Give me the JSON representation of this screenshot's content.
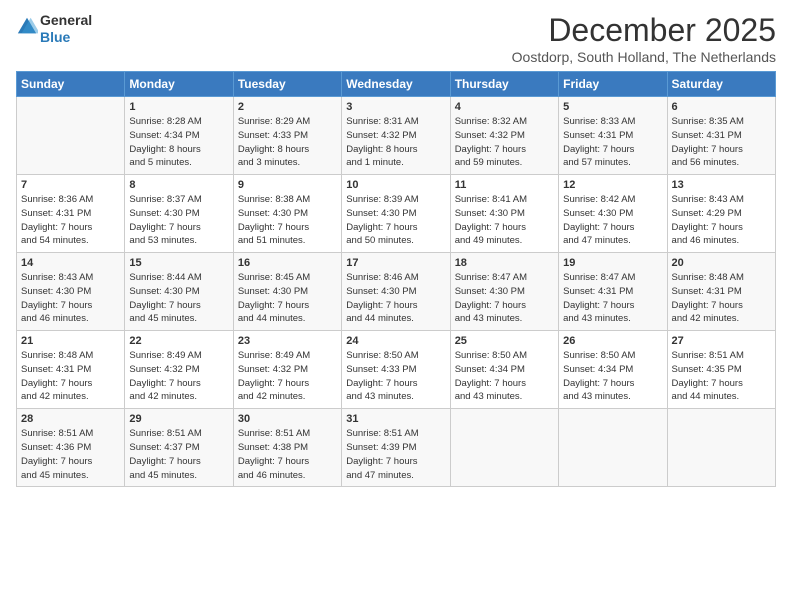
{
  "header": {
    "logo_general": "General",
    "logo_blue": "Blue",
    "title": "December 2025",
    "subtitle": "Oostdorp, South Holland, The Netherlands"
  },
  "weekdays": [
    "Sunday",
    "Monday",
    "Tuesday",
    "Wednesday",
    "Thursday",
    "Friday",
    "Saturday"
  ],
  "weeks": [
    [
      {
        "day": "",
        "info": ""
      },
      {
        "day": "1",
        "info": "Sunrise: 8:28 AM\nSunset: 4:34 PM\nDaylight: 8 hours\nand 5 minutes."
      },
      {
        "day": "2",
        "info": "Sunrise: 8:29 AM\nSunset: 4:33 PM\nDaylight: 8 hours\nand 3 minutes."
      },
      {
        "day": "3",
        "info": "Sunrise: 8:31 AM\nSunset: 4:32 PM\nDaylight: 8 hours\nand 1 minute."
      },
      {
        "day": "4",
        "info": "Sunrise: 8:32 AM\nSunset: 4:32 PM\nDaylight: 7 hours\nand 59 minutes."
      },
      {
        "day": "5",
        "info": "Sunrise: 8:33 AM\nSunset: 4:31 PM\nDaylight: 7 hours\nand 57 minutes."
      },
      {
        "day": "6",
        "info": "Sunrise: 8:35 AM\nSunset: 4:31 PM\nDaylight: 7 hours\nand 56 minutes."
      }
    ],
    [
      {
        "day": "7",
        "info": "Sunrise: 8:36 AM\nSunset: 4:31 PM\nDaylight: 7 hours\nand 54 minutes."
      },
      {
        "day": "8",
        "info": "Sunrise: 8:37 AM\nSunset: 4:30 PM\nDaylight: 7 hours\nand 53 minutes."
      },
      {
        "day": "9",
        "info": "Sunrise: 8:38 AM\nSunset: 4:30 PM\nDaylight: 7 hours\nand 51 minutes."
      },
      {
        "day": "10",
        "info": "Sunrise: 8:39 AM\nSunset: 4:30 PM\nDaylight: 7 hours\nand 50 minutes."
      },
      {
        "day": "11",
        "info": "Sunrise: 8:41 AM\nSunset: 4:30 PM\nDaylight: 7 hours\nand 49 minutes."
      },
      {
        "day": "12",
        "info": "Sunrise: 8:42 AM\nSunset: 4:30 PM\nDaylight: 7 hours\nand 47 minutes."
      },
      {
        "day": "13",
        "info": "Sunrise: 8:43 AM\nSunset: 4:29 PM\nDaylight: 7 hours\nand 46 minutes."
      }
    ],
    [
      {
        "day": "14",
        "info": "Sunrise: 8:43 AM\nSunset: 4:30 PM\nDaylight: 7 hours\nand 46 minutes."
      },
      {
        "day": "15",
        "info": "Sunrise: 8:44 AM\nSunset: 4:30 PM\nDaylight: 7 hours\nand 45 minutes."
      },
      {
        "day": "16",
        "info": "Sunrise: 8:45 AM\nSunset: 4:30 PM\nDaylight: 7 hours\nand 44 minutes."
      },
      {
        "day": "17",
        "info": "Sunrise: 8:46 AM\nSunset: 4:30 PM\nDaylight: 7 hours\nand 44 minutes."
      },
      {
        "day": "18",
        "info": "Sunrise: 8:47 AM\nSunset: 4:30 PM\nDaylight: 7 hours\nand 43 minutes."
      },
      {
        "day": "19",
        "info": "Sunrise: 8:47 AM\nSunset: 4:31 PM\nDaylight: 7 hours\nand 43 minutes."
      },
      {
        "day": "20",
        "info": "Sunrise: 8:48 AM\nSunset: 4:31 PM\nDaylight: 7 hours\nand 42 minutes."
      }
    ],
    [
      {
        "day": "21",
        "info": "Sunrise: 8:48 AM\nSunset: 4:31 PM\nDaylight: 7 hours\nand 42 minutes."
      },
      {
        "day": "22",
        "info": "Sunrise: 8:49 AM\nSunset: 4:32 PM\nDaylight: 7 hours\nand 42 minutes."
      },
      {
        "day": "23",
        "info": "Sunrise: 8:49 AM\nSunset: 4:32 PM\nDaylight: 7 hours\nand 42 minutes."
      },
      {
        "day": "24",
        "info": "Sunrise: 8:50 AM\nSunset: 4:33 PM\nDaylight: 7 hours\nand 43 minutes."
      },
      {
        "day": "25",
        "info": "Sunrise: 8:50 AM\nSunset: 4:34 PM\nDaylight: 7 hours\nand 43 minutes."
      },
      {
        "day": "26",
        "info": "Sunrise: 8:50 AM\nSunset: 4:34 PM\nDaylight: 7 hours\nand 43 minutes."
      },
      {
        "day": "27",
        "info": "Sunrise: 8:51 AM\nSunset: 4:35 PM\nDaylight: 7 hours\nand 44 minutes."
      }
    ],
    [
      {
        "day": "28",
        "info": "Sunrise: 8:51 AM\nSunset: 4:36 PM\nDaylight: 7 hours\nand 45 minutes."
      },
      {
        "day": "29",
        "info": "Sunrise: 8:51 AM\nSunset: 4:37 PM\nDaylight: 7 hours\nand 45 minutes."
      },
      {
        "day": "30",
        "info": "Sunrise: 8:51 AM\nSunset: 4:38 PM\nDaylight: 7 hours\nand 46 minutes."
      },
      {
        "day": "31",
        "info": "Sunrise: 8:51 AM\nSunset: 4:39 PM\nDaylight: 7 hours\nand 47 minutes."
      },
      {
        "day": "",
        "info": ""
      },
      {
        "day": "",
        "info": ""
      },
      {
        "day": "",
        "info": ""
      }
    ]
  ]
}
